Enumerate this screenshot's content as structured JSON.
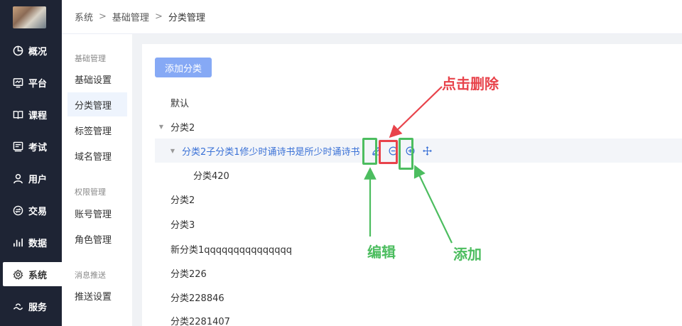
{
  "nav": {
    "items": [
      {
        "label": "概况",
        "icon": "pie-chart-icon"
      },
      {
        "label": "平台",
        "icon": "monitor-icon"
      },
      {
        "label": "课程",
        "icon": "book-icon"
      },
      {
        "label": "考试",
        "icon": "exam-icon"
      },
      {
        "label": "用户",
        "icon": "user-icon"
      },
      {
        "label": "交易",
        "icon": "exchange-icon"
      },
      {
        "label": "数据",
        "icon": "bar-chart-icon"
      },
      {
        "label": "系统",
        "icon": "gear-icon",
        "active": true
      },
      {
        "label": "服务",
        "icon": "service-icon"
      }
    ]
  },
  "breadcrumb": {
    "items": [
      "系统",
      "基础管理",
      "分类管理"
    ]
  },
  "submenu": {
    "groups": [
      {
        "title": "基础管理",
        "items": [
          "基础设置",
          "分类管理",
          "标签管理",
          "域名管理"
        ]
      },
      {
        "title": "权限管理",
        "items": [
          "账号管理",
          "角色管理"
        ]
      },
      {
        "title": "消息推送",
        "items": [
          "推送设置"
        ]
      }
    ],
    "active_item": "分类管理"
  },
  "content": {
    "add_button": "添加分类",
    "tree": [
      {
        "label": "默认",
        "level": 0
      },
      {
        "label": "分类2",
        "level": 0,
        "expanded": true
      },
      {
        "label": "分类2子分类1修少时诵诗书是所少时诵诗书",
        "level": 1,
        "expanded": true,
        "highlighted": true
      },
      {
        "label": "分类420",
        "level": 2
      },
      {
        "label": "分类2",
        "level": 0
      },
      {
        "label": "分类3",
        "level": 0
      },
      {
        "label": "新分类1qqqqqqqqqqqqqqq",
        "level": 0
      },
      {
        "label": "分类226",
        "level": 0
      },
      {
        "label": "分类228846",
        "level": 0
      },
      {
        "label": "分类2281407",
        "level": 0
      }
    ],
    "row_actions": [
      "edit-icon",
      "remove-circle-icon",
      "add-circle-icon",
      "move-icon"
    ]
  },
  "annotations": {
    "delete_label": "点击删除",
    "edit_label": "编辑",
    "add_label": "添加",
    "red_color": "#e8434b",
    "green_color": "#4cbd5f"
  }
}
